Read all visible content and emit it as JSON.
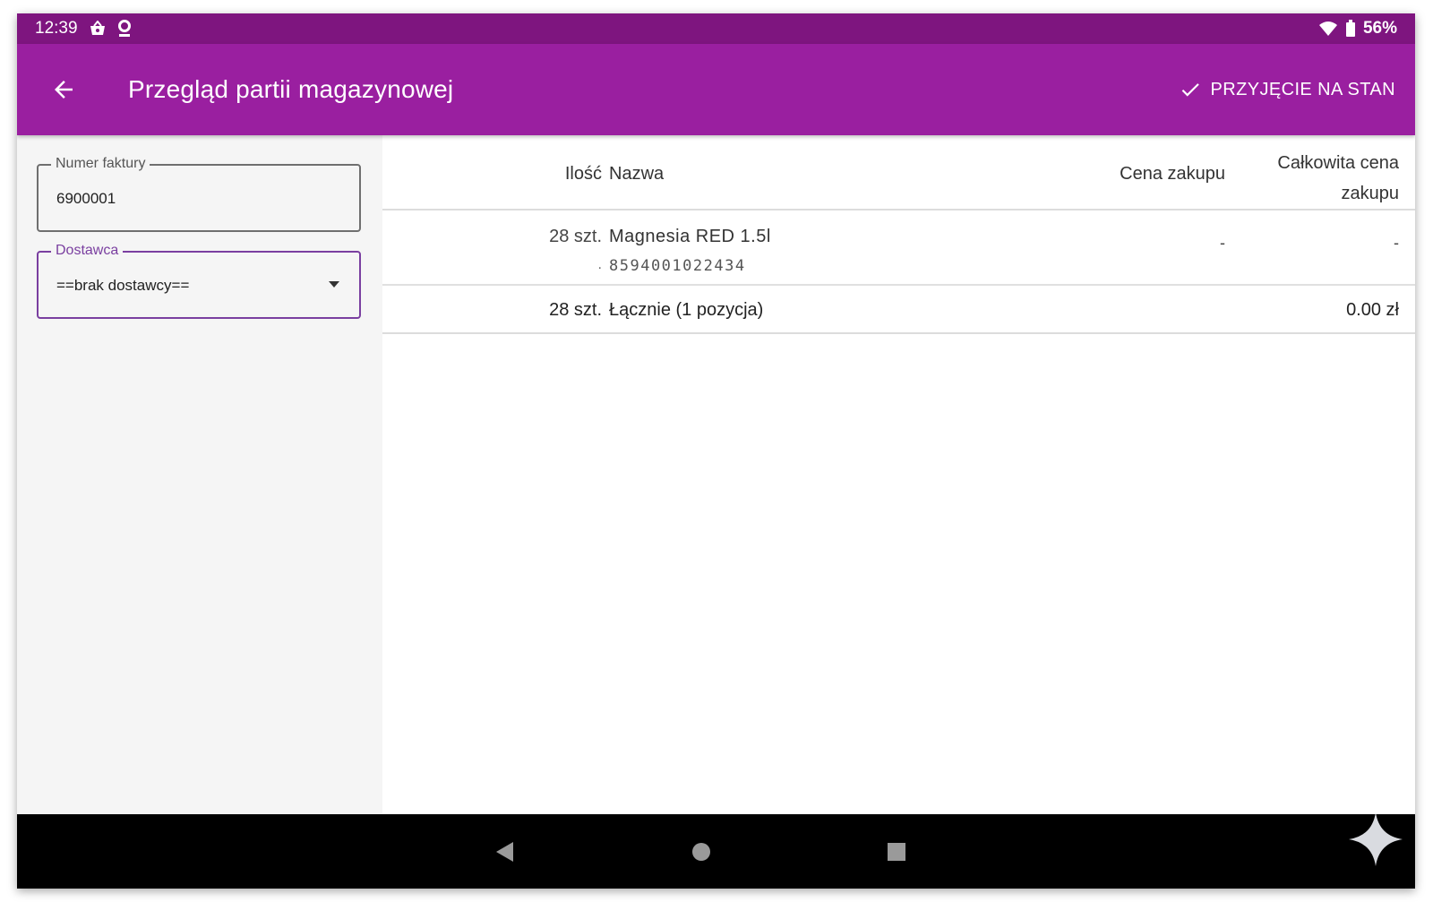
{
  "status_bar": {
    "time": "12:39",
    "battery": "56%",
    "icons": [
      "cart-notification-icon",
      "location-notification-icon",
      "wifi-icon",
      "battery-icon"
    ]
  },
  "app_bar": {
    "title": "Przegląd partii magazynowej",
    "action_label": "PRZYJĘCIE NA STAN"
  },
  "form": {
    "invoice": {
      "label": "Numer faktury",
      "value": "6900001"
    },
    "supplier": {
      "label": "Dostawca",
      "value": "==brak dostawcy=="
    }
  },
  "table": {
    "headers": {
      "qty": "Ilość",
      "name": "Nazwa",
      "price": "Cena zakupu",
      "total_line1": "Całkowita cena",
      "total_line2": "zakupu"
    },
    "rows": [
      {
        "qty": "28 szt.",
        "sub": ".",
        "name": "Magnesia RED 1.5l",
        "code": "8594001022434",
        "price": "-",
        "total": "-"
      }
    ],
    "summary": {
      "qty": "28 szt.",
      "label": "Łącznie (1 pozycja)",
      "total": "0.00 zł"
    }
  },
  "colors": {
    "status_bar": "#7e157f",
    "app_bar": "#9a1fa0",
    "focus": "#7a3fa0",
    "nav_bar": "#000000"
  }
}
